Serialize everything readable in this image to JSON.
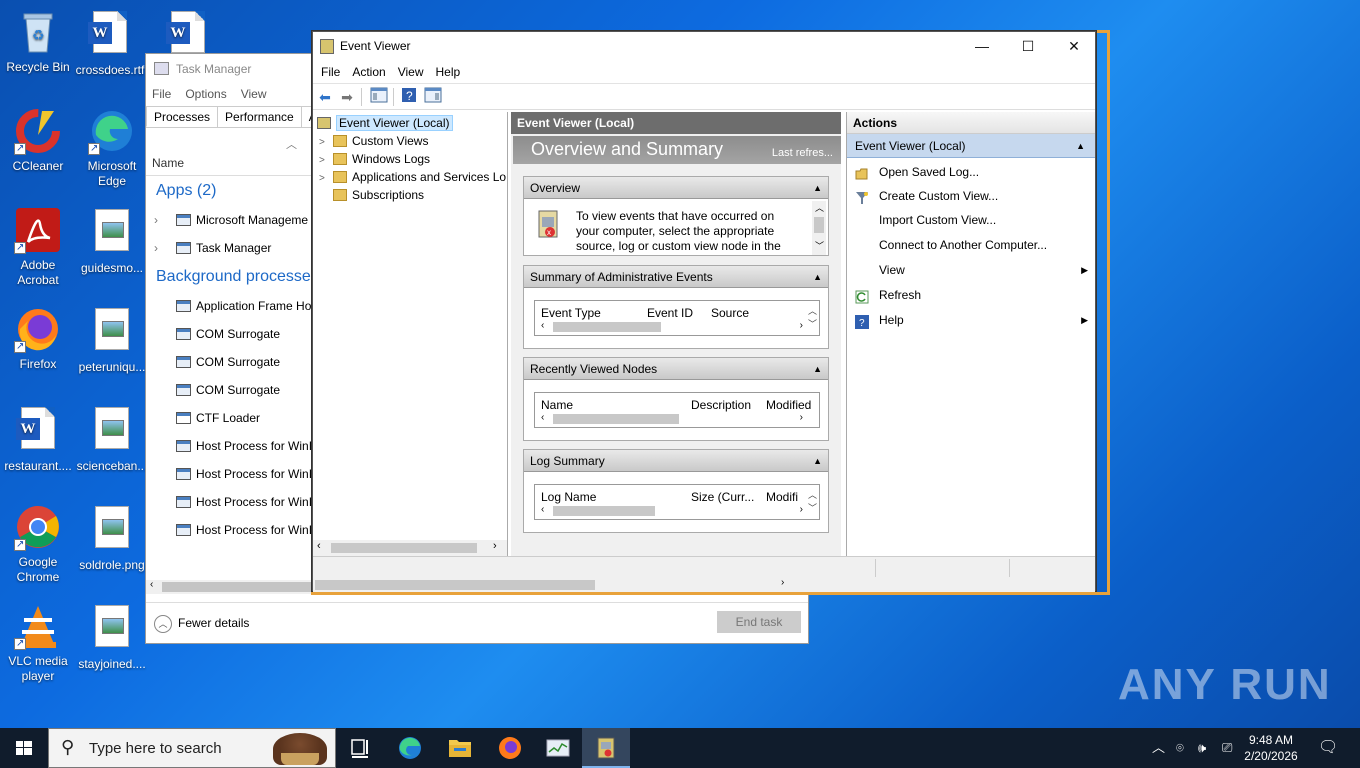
{
  "desktop": {
    "icons": {
      "recycle_bin": "Recycle Bin",
      "crossdoes": "crossdoes.rtf",
      "ccleaner": "CCleaner",
      "edge": "Microsoft Edge",
      "acrobat": "Adobe Acrobat",
      "guidesmo": "guidesmo...",
      "firefox": "Firefox",
      "peterunique": "peteruniqu...",
      "restaurant": "restaurant....",
      "sciencebank": "scienceban...",
      "chrome": "Google Chrome",
      "soldrole": "soldrole.png",
      "vlc": "VLC media player",
      "stayjoined": "stayjoined...."
    },
    "watermark": "ANY RUN"
  },
  "task_manager": {
    "title": "Task Manager",
    "menu": [
      "File",
      "Options",
      "View"
    ],
    "tabs": [
      "Processes",
      "Performance",
      "Ap"
    ],
    "col_name": "Name",
    "apps_header": "Apps (2)",
    "apps": [
      "Microsoft Manageme",
      "Task Manager"
    ],
    "bg_header": "Background processes",
    "bg": [
      "Application Frame Ho",
      "COM Surrogate",
      "COM Surrogate",
      "COM Surrogate",
      "CTF Loader",
      "Host Process for WinI",
      "Host Process for WinI",
      "Host Process for WinI",
      "Host Process for WinI"
    ],
    "fewer_details": "Fewer details",
    "end_task": "End task"
  },
  "event_viewer": {
    "title": "Event Viewer",
    "menu": [
      "File",
      "Action",
      "View",
      "Help"
    ],
    "tree": {
      "root": "Event Viewer (Local)",
      "items": [
        "Custom Views",
        "Windows Logs",
        "Applications and Services Lo",
        "Subscriptions"
      ]
    },
    "center": {
      "header": "Event Viewer (Local)",
      "overview_title": "Overview and Summary",
      "last_refresh": "Last refres...",
      "overview": {
        "label": "Overview",
        "text_lines": [
          "To view events that have occurred on",
          "your computer, select the appropriate",
          "source, log or custom view node in the"
        ]
      },
      "summary": {
        "label": "Summary of Administrative Events",
        "columns": [
          "Event Type",
          "Event ID",
          "Source"
        ]
      },
      "recent": {
        "label": "Recently Viewed Nodes",
        "columns": [
          "Name",
          "Description",
          "Modified"
        ]
      },
      "log_summary": {
        "label": "Log Summary",
        "columns": [
          "Log Name",
          "Size (Curr...",
          "Modifi"
        ]
      }
    },
    "actions": {
      "header": "Actions",
      "section": "Event Viewer (Local)",
      "items": [
        "Open Saved Log...",
        "Create Custom View...",
        "Import Custom View...",
        "Connect to Another Computer...",
        "View",
        "Refresh",
        "Help"
      ]
    }
  },
  "taskbar": {
    "search_placeholder": "Type here to search",
    "time": "9:48 AM",
    "date": "2/20/2026"
  }
}
